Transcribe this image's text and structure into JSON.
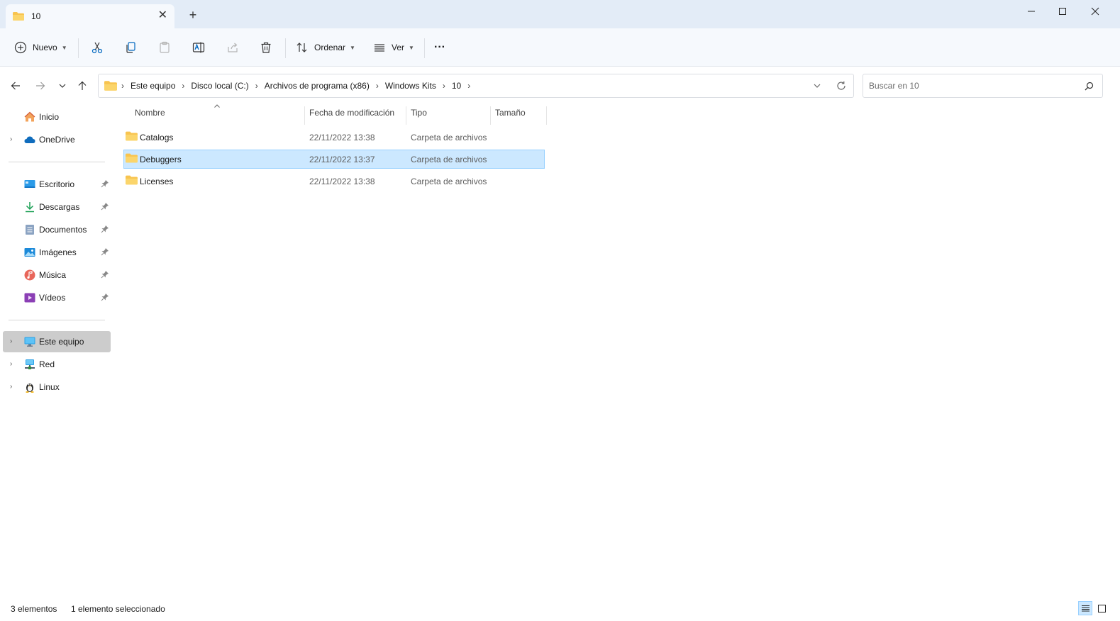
{
  "window": {
    "tab_title": "10",
    "new_tab_symbol": "+",
    "close_tab_symbol": "✕"
  },
  "toolbar": {
    "new_label": "Nuevo",
    "sort_label": "Ordenar",
    "view_label": "Ver",
    "more_symbol": "···"
  },
  "address": {
    "crumbs": [
      "Este equipo",
      "Disco local (C:)",
      "Archivos de programa (x86)",
      "Windows Kits",
      "10"
    ],
    "separator": "›"
  },
  "search": {
    "placeholder": "Buscar en 10"
  },
  "sidebar": {
    "items": [
      {
        "label": "Inicio",
        "icon": "home-icon"
      },
      {
        "label": "OneDrive",
        "icon": "onedrive-cloud-icon"
      },
      {
        "label": "Escritorio",
        "icon": "desktop-icon",
        "pinned": true
      },
      {
        "label": "Descargas",
        "icon": "download-icon",
        "pinned": true
      },
      {
        "label": "Documentos",
        "icon": "document-icon",
        "pinned": true
      },
      {
        "label": "Imágenes",
        "icon": "pictures-icon",
        "pinned": true
      },
      {
        "label": "Música",
        "icon": "music-icon",
        "pinned": true
      },
      {
        "label": "Vídeos",
        "icon": "videos-icon",
        "pinned": true
      },
      {
        "label": "Este equipo",
        "icon": "computer-icon",
        "selected": true
      },
      {
        "label": "Red",
        "icon": "network-icon"
      },
      {
        "label": "Linux",
        "icon": "linux-penguin-icon"
      }
    ],
    "chevron": "›"
  },
  "columns": {
    "name": "Nombre",
    "date": "Fecha de modificación",
    "type": "Tipo",
    "size": "Tamaño"
  },
  "files": [
    {
      "name": "Catalogs",
      "date": "22/11/2022 13:38",
      "type": "Carpeta de archivos",
      "selected": false
    },
    {
      "name": "Debuggers",
      "date": "22/11/2022 13:37",
      "type": "Carpeta de archivos",
      "selected": true
    },
    {
      "name": "Licenses",
      "date": "22/11/2022 13:38",
      "type": "Carpeta de archivos",
      "selected": false
    }
  ],
  "status": {
    "count": "3 elementos",
    "selection": "1 elemento seleccionado"
  },
  "colors": {
    "titlebar": "#e3ecf7",
    "selection_bg": "#cce8ff",
    "selection_border": "#99d1ff",
    "folder": "#f8c44f",
    "accent": "#0067c0"
  }
}
